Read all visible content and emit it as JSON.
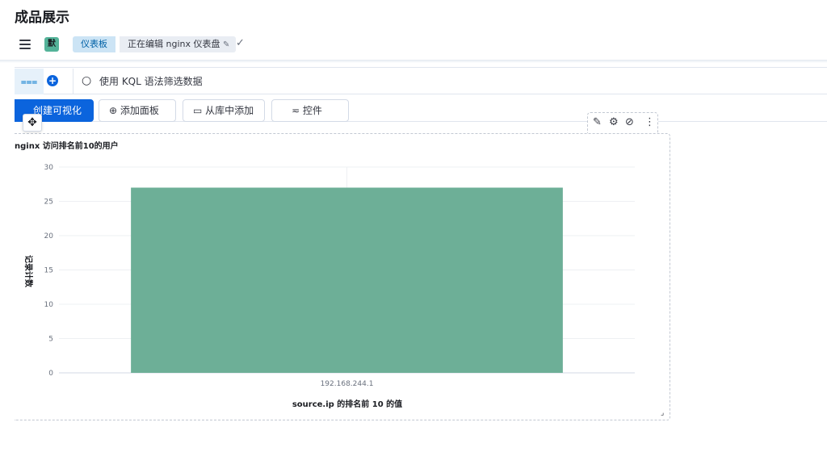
{
  "page": {
    "title": "成品展示"
  },
  "header": {
    "space_initial": "默",
    "breadcrumbs": [
      "仪表板",
      "正在编辑 nginx 仪表盘"
    ]
  },
  "query": {
    "placeholder": "使用 KQL 语法筛选数据"
  },
  "toolbar": {
    "create_viz": "创建可视化",
    "add_panel": "添加面板",
    "add_from_library": "从库中添加",
    "controls": "控件"
  },
  "panel": {
    "title": "nginx 访问排名前10的用户"
  },
  "colors": {
    "accent": "#0b64dd",
    "bar": "#6daf97",
    "space_badge": "#54b399"
  },
  "chart_data": {
    "type": "bar",
    "categories": [
      "192.168.244.1"
    ],
    "values": [
      27
    ],
    "xlabel": "source.ip 的排名前 10 的值",
    "ylabel": "记录计数",
    "ylim": [
      0,
      30
    ],
    "yticks": [
      0,
      5,
      10,
      15,
      20,
      25,
      30
    ],
    "grid": true
  }
}
